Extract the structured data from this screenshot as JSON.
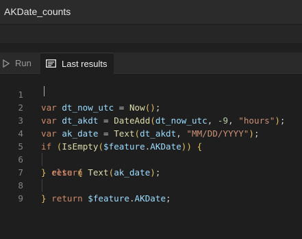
{
  "window": {
    "title": "AKDate_counts"
  },
  "tabs": {
    "run_label": "Run",
    "results_label": "Last results"
  },
  "editor": {
    "line_numbers": [
      "1",
      "2",
      "3",
      "4",
      "5",
      "6",
      "7",
      "8",
      "9"
    ],
    "lines": [
      "var dt_now_utc = Now();",
      "var dt_akdt = DateAdd(dt_now_utc, -9, \"hours\");",
      "var ak_date = Text(dt_akdt, \"MM/DD/YYYY\");",
      "if (IsEmpty($feature.AKDate)) {",
      "  return Text(ak_date);",
      "} else {",
      "  return $feature.AKDate;",
      "}",
      ""
    ]
  },
  "colors": {
    "background": "#1e1e1e",
    "keyword": "#d08a6a",
    "function": "#dcdcaa",
    "string": "#ce9178",
    "number": "#b5cea8"
  }
}
